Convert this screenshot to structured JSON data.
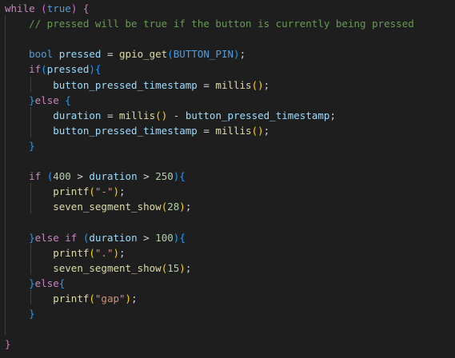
{
  "editor": {
    "language": "C",
    "theme": "dark",
    "colors": {
      "background": "#1e1e1e",
      "keyword": "#569cd6",
      "control": "#c586c0",
      "function": "#dcdcaa",
      "variable": "#9cdcfe",
      "number": "#b5cea8",
      "string": "#ce9178",
      "comment": "#6a9955",
      "bracket_level_1": "#ffd700",
      "bracket_level_2": "#da70d6",
      "bracket_level_3": "#179fff"
    },
    "lines": [
      {
        "tokens": [
          {
            "t": "while",
            "c": "ctl"
          },
          {
            "t": " ",
            "c": "op"
          },
          {
            "t": "(",
            "c": "b2"
          },
          {
            "t": "true",
            "c": "kw"
          },
          {
            "t": ")",
            "c": "b2"
          },
          {
            "t": " ",
            "c": "op"
          },
          {
            "t": "{",
            "c": "b2"
          }
        ]
      },
      {
        "tokens": [
          {
            "t": "    // pressed will be true if the button is currently being pressed",
            "c": "cmt"
          }
        ]
      },
      {
        "tokens": []
      },
      {
        "tokens": [
          {
            "t": "    ",
            "c": "op"
          },
          {
            "t": "bool",
            "c": "ty"
          },
          {
            "t": " ",
            "c": "op"
          },
          {
            "t": "pressed",
            "c": "var"
          },
          {
            "t": " = ",
            "c": "op"
          },
          {
            "t": "gpio_get",
            "c": "fn"
          },
          {
            "t": "(",
            "c": "b3"
          },
          {
            "t": "BUTTON_PIN",
            "c": "mac"
          },
          {
            "t": ")",
            "c": "b3"
          },
          {
            "t": ";",
            "c": "op"
          }
        ]
      },
      {
        "tokens": [
          {
            "t": "    ",
            "c": "op"
          },
          {
            "t": "if",
            "c": "ctl"
          },
          {
            "t": "(",
            "c": "b3"
          },
          {
            "t": "pressed",
            "c": "var"
          },
          {
            "t": ")",
            "c": "b3"
          },
          {
            "t": "{",
            "c": "b3"
          }
        ]
      },
      {
        "tokens": [
          {
            "t": "        ",
            "c": "op"
          },
          {
            "t": "button_pressed_timestamp",
            "c": "var"
          },
          {
            "t": " = ",
            "c": "op"
          },
          {
            "t": "millis",
            "c": "fn"
          },
          {
            "t": "()",
            "c": "b1"
          },
          {
            "t": ";",
            "c": "op"
          }
        ]
      },
      {
        "tokens": [
          {
            "t": "    ",
            "c": "op"
          },
          {
            "t": "}",
            "c": "b3"
          },
          {
            "t": "else",
            "c": "ctl"
          },
          {
            "t": " ",
            "c": "op"
          },
          {
            "t": "{",
            "c": "b3"
          }
        ]
      },
      {
        "tokens": [
          {
            "t": "        ",
            "c": "op"
          },
          {
            "t": "duration",
            "c": "var"
          },
          {
            "t": " = ",
            "c": "op"
          },
          {
            "t": "millis",
            "c": "fn"
          },
          {
            "t": "()",
            "c": "b1"
          },
          {
            "t": " - ",
            "c": "op"
          },
          {
            "t": "button_pressed_timestamp",
            "c": "var"
          },
          {
            "t": ";",
            "c": "op"
          }
        ]
      },
      {
        "tokens": [
          {
            "t": "        ",
            "c": "op"
          },
          {
            "t": "button_pressed_timestamp",
            "c": "var"
          },
          {
            "t": " = ",
            "c": "op"
          },
          {
            "t": "millis",
            "c": "fn"
          },
          {
            "t": "()",
            "c": "b1"
          },
          {
            "t": ";",
            "c": "op"
          }
        ]
      },
      {
        "tokens": [
          {
            "t": "    ",
            "c": "op"
          },
          {
            "t": "}",
            "c": "b3"
          }
        ]
      },
      {
        "tokens": []
      },
      {
        "tokens": [
          {
            "t": "    ",
            "c": "op"
          },
          {
            "t": "if",
            "c": "ctl"
          },
          {
            "t": " ",
            "c": "op"
          },
          {
            "t": "(",
            "c": "b3"
          },
          {
            "t": "400",
            "c": "num"
          },
          {
            "t": " > ",
            "c": "op"
          },
          {
            "t": "duration",
            "c": "var"
          },
          {
            "t": " > ",
            "c": "op"
          },
          {
            "t": "250",
            "c": "num"
          },
          {
            "t": ")",
            "c": "b3"
          },
          {
            "t": "{",
            "c": "b3"
          }
        ]
      },
      {
        "tokens": [
          {
            "t": "        ",
            "c": "op"
          },
          {
            "t": "printf",
            "c": "fn"
          },
          {
            "t": "(",
            "c": "b1"
          },
          {
            "t": "\"-\"",
            "c": "str"
          },
          {
            "t": ")",
            "c": "b1"
          },
          {
            "t": ";",
            "c": "op"
          }
        ]
      },
      {
        "tokens": [
          {
            "t": "        ",
            "c": "op"
          },
          {
            "t": "seven_segment_show",
            "c": "fn"
          },
          {
            "t": "(",
            "c": "b1"
          },
          {
            "t": "28",
            "c": "num"
          },
          {
            "t": ")",
            "c": "b1"
          },
          {
            "t": ";",
            "c": "op"
          }
        ]
      },
      {
        "tokens": []
      },
      {
        "tokens": [
          {
            "t": "    ",
            "c": "op"
          },
          {
            "t": "}",
            "c": "b3"
          },
          {
            "t": "else",
            "c": "ctl"
          },
          {
            "t": " ",
            "c": "op"
          },
          {
            "t": "if",
            "c": "ctl"
          },
          {
            "t": " ",
            "c": "op"
          },
          {
            "t": "(",
            "c": "b3"
          },
          {
            "t": "duration",
            "c": "var"
          },
          {
            "t": " > ",
            "c": "op"
          },
          {
            "t": "100",
            "c": "num"
          },
          {
            "t": ")",
            "c": "b3"
          },
          {
            "t": "{",
            "c": "b3"
          }
        ]
      },
      {
        "tokens": [
          {
            "t": "        ",
            "c": "op"
          },
          {
            "t": "printf",
            "c": "fn"
          },
          {
            "t": "(",
            "c": "b1"
          },
          {
            "t": "\".\"",
            "c": "str"
          },
          {
            "t": ")",
            "c": "b1"
          },
          {
            "t": ";",
            "c": "op"
          }
        ]
      },
      {
        "tokens": [
          {
            "t": "        ",
            "c": "op"
          },
          {
            "t": "seven_segment_show",
            "c": "fn"
          },
          {
            "t": "(",
            "c": "b1"
          },
          {
            "t": "15",
            "c": "num"
          },
          {
            "t": ")",
            "c": "b1"
          },
          {
            "t": ";",
            "c": "op"
          }
        ]
      },
      {
        "tokens": [
          {
            "t": "    ",
            "c": "op"
          },
          {
            "t": "}",
            "c": "b3"
          },
          {
            "t": "else",
            "c": "ctl"
          },
          {
            "t": "{",
            "c": "b3"
          }
        ]
      },
      {
        "tokens": [
          {
            "t": "        ",
            "c": "op"
          },
          {
            "t": "printf",
            "c": "fn"
          },
          {
            "t": "(",
            "c": "b1"
          },
          {
            "t": "\"gap\"",
            "c": "str"
          },
          {
            "t": ")",
            "c": "b1"
          },
          {
            "t": ";",
            "c": "op"
          }
        ]
      },
      {
        "tokens": [
          {
            "t": "    ",
            "c": "op"
          },
          {
            "t": "}",
            "c": "b3"
          }
        ]
      },
      {
        "tokens": []
      },
      {
        "tokens": [
          {
            "t": "}",
            "c": "b2"
          }
        ]
      }
    ]
  }
}
